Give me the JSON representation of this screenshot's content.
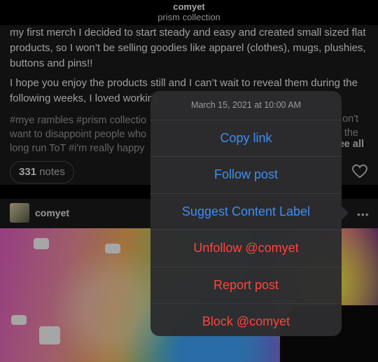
{
  "header": {
    "title": "comyet",
    "subtitle": "prism collection"
  },
  "post": {
    "paragraph1": "my first merch I decided to start steady and easy and created small sized flat products, so I won’t be selling goodies like apparel (clothes), mugs, plushies, buttons and pins!!",
    "paragraph2": "I hope you enjoy the products still and I can’t wait to reveal them during the following weeks, I loved working",
    "tags_line1": "#mye rambles  #prism collectio",
    "tags_line2": "want to disappoint people who",
    "tags_line3": "long run ToT  #i'm really happy",
    "tags_right1": "on't",
    "tags_right2": "the",
    "see_all": "ee all",
    "notes_count": "331",
    "notes_label": "notes"
  },
  "post2": {
    "username": "comyet",
    "more": "•••"
  },
  "menu": {
    "date": "March 15, 2021 at 10:00 AM",
    "items": [
      {
        "label": "Copy link",
        "style": "blue"
      },
      {
        "label": "Follow post",
        "style": "blue"
      },
      {
        "label": "Suggest Content Label",
        "style": "blue"
      },
      {
        "label": "Unfollow @comyet",
        "style": "red"
      },
      {
        "label": "Report post",
        "style": "red"
      },
      {
        "label": "Block @comyet",
        "style": "red"
      }
    ]
  },
  "colors": {
    "blue": "#3d8ef7",
    "red": "#ff453a",
    "sheet": "#2c2c2e"
  },
  "icons": [
    "heart-icon",
    "more-icon"
  ]
}
